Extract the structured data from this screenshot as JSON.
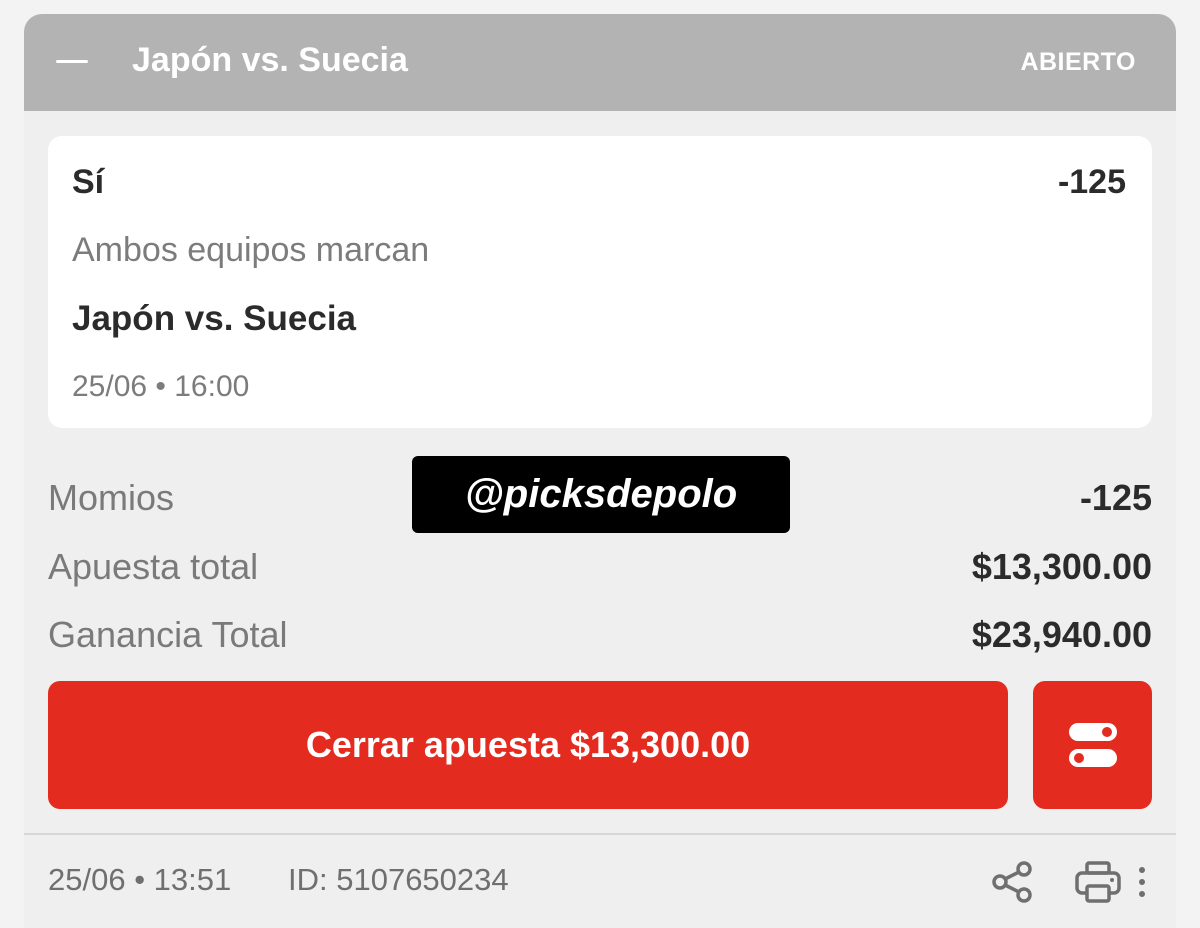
{
  "header": {
    "title": "Japón vs. Suecia",
    "status": "ABIERTO"
  },
  "selection": {
    "pick": "Sí",
    "odds": "-125",
    "market": "Ambos equipos marcan",
    "event": "Japón vs. Suecia",
    "datetime": "25/06 • 16:00"
  },
  "watermark": "@picksdepolo",
  "summary": {
    "momios_label": "Momios",
    "momios_value": "-125",
    "stake_label": "Apuesta total",
    "stake_value": "$13,300.00",
    "payout_label": "Ganancia Total",
    "payout_value": "$23,940.00"
  },
  "actions": {
    "cashout_label": "Cerrar apuesta $13,300.00"
  },
  "footer": {
    "placed": "25/06 • 13:51",
    "id": "ID: 5107650234"
  },
  "icons": {
    "collapse": "minus-icon",
    "toggle": "toggle-icon",
    "share": "share-icon",
    "print": "printer-icon",
    "more": "more-vertical-icon"
  },
  "colors": {
    "header_bg": "#b3b3b3",
    "accent_red": "#e32b20",
    "card_bg": "#efefef",
    "text_dark": "#2b2b2b",
    "text_muted": "#7a7a7a"
  }
}
